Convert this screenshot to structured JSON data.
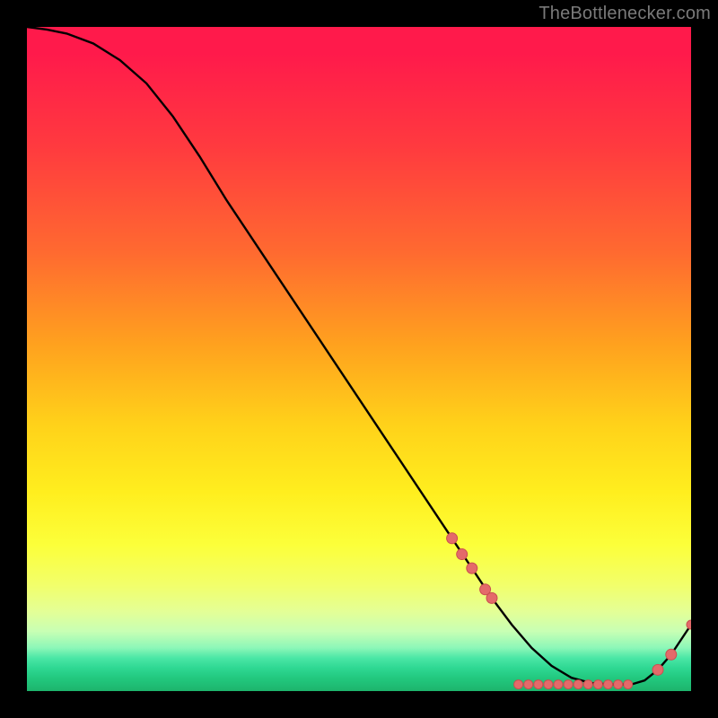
{
  "attribution": "TheBottlenecker.com",
  "chart_data": {
    "type": "line",
    "title": "",
    "xlabel": "",
    "ylabel": "",
    "xlim": [
      0,
      100
    ],
    "ylim": [
      0,
      100
    ],
    "series": [
      {
        "name": "curve",
        "x": [
          0,
          3,
          6,
          10,
          14,
          18,
          22,
          26,
          30,
          35,
          40,
          45,
          50,
          55,
          60,
          64,
          67,
          70,
          73,
          76,
          79,
          82,
          85,
          88,
          91,
          93,
          95,
          97,
          100
        ],
        "y": [
          100,
          99.6,
          99.0,
          97.5,
          95.0,
          91.5,
          86.5,
          80.5,
          74.0,
          66.5,
          59.0,
          51.5,
          44.0,
          36.5,
          29.0,
          23.0,
          18.5,
          14.0,
          10.0,
          6.5,
          3.8,
          2.0,
          1.2,
          1.0,
          1.0,
          1.6,
          3.2,
          5.5,
          10.0
        ]
      }
    ],
    "markers": [
      {
        "x": 64.0,
        "y": 23.0,
        "r": 6
      },
      {
        "x": 65.5,
        "y": 20.6,
        "r": 6
      },
      {
        "x": 67.0,
        "y": 18.5,
        "r": 6
      },
      {
        "x": 69.0,
        "y": 15.3,
        "r": 6
      },
      {
        "x": 70.0,
        "y": 14.0,
        "r": 6
      },
      {
        "x": 74.0,
        "y": 1.0,
        "r": 5
      },
      {
        "x": 75.5,
        "y": 1.0,
        "r": 5
      },
      {
        "x": 77.0,
        "y": 1.0,
        "r": 5
      },
      {
        "x": 78.5,
        "y": 1.0,
        "r": 5
      },
      {
        "x": 80.0,
        "y": 1.0,
        "r": 5
      },
      {
        "x": 81.5,
        "y": 1.0,
        "r": 5
      },
      {
        "x": 83.0,
        "y": 1.0,
        "r": 5
      },
      {
        "x": 84.5,
        "y": 1.0,
        "r": 5
      },
      {
        "x": 86.0,
        "y": 1.0,
        "r": 5
      },
      {
        "x": 87.5,
        "y": 1.0,
        "r": 5
      },
      {
        "x": 89.0,
        "y": 1.0,
        "r": 5
      },
      {
        "x": 90.5,
        "y": 1.0,
        "r": 5
      },
      {
        "x": 95.0,
        "y": 3.2,
        "r": 6
      },
      {
        "x": 97.0,
        "y": 5.5,
        "r": 6
      },
      {
        "x": 100.0,
        "y": 10.0,
        "r": 5
      }
    ],
    "colors": {
      "curve": "#000000",
      "marker_fill": "#e46a6a",
      "marker_stroke": "#c94f4f"
    }
  }
}
